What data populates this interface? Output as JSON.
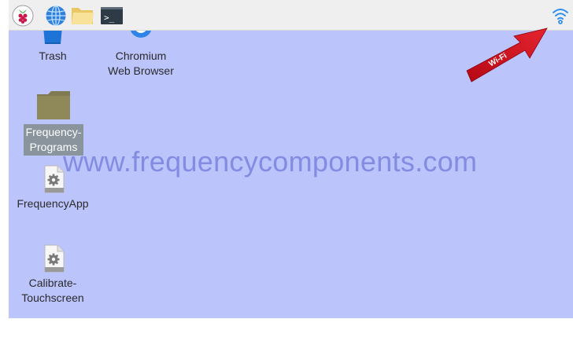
{
  "taskbar": {
    "menu_icon": "raspberry-pi-icon",
    "browser_icon": "globe-icon",
    "files_icon": "folder-icon",
    "terminal_icon": "terminal-icon",
    "terminal_glyph": ">_",
    "wifi_icon": "wifi-icon"
  },
  "desktop": {
    "icons": [
      {
        "label": "Trash",
        "icon": "trash-icon"
      },
      {
        "label": "Chromium\nWeb Browser",
        "icon": "chromium-icon"
      },
      {
        "label": "Frequency-\nPrograms",
        "icon": "folder-icon",
        "selected": true
      },
      {
        "label": "FrequencyApp",
        "icon": "executable-file-icon"
      },
      {
        "label": "Calibrate-\nTouchscreen",
        "icon": "executable-file-icon"
      }
    ]
  },
  "annotation": {
    "arrow_label": "Wi-Fi",
    "arrow_color": "#d4101e"
  },
  "watermark": {
    "text": "www.frequencycomponents.com"
  },
  "colors": {
    "desktop_bg": "#bcc4fc",
    "taskbar_bg": "#efefef"
  }
}
